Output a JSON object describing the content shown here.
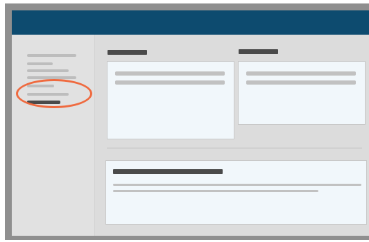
{
  "layout": {
    "header": {
      "background": "#0d4b6f"
    },
    "sidebar": {
      "items": [
        {
          "type": "placeholder-line"
        },
        {
          "type": "placeholder-line"
        },
        {
          "type": "placeholder-line"
        },
        {
          "type": "placeholder-line"
        },
        {
          "type": "placeholder-line"
        },
        {
          "type": "placeholder-line"
        },
        {
          "type": "placeholder-line-active"
        }
      ],
      "highlight_color": "#ef6a3f"
    },
    "main": {
      "cards": [
        {
          "type": "card",
          "content": "placeholder"
        },
        {
          "type": "card",
          "content": "placeholder"
        },
        {
          "type": "card",
          "content": "placeholder"
        }
      ]
    }
  }
}
